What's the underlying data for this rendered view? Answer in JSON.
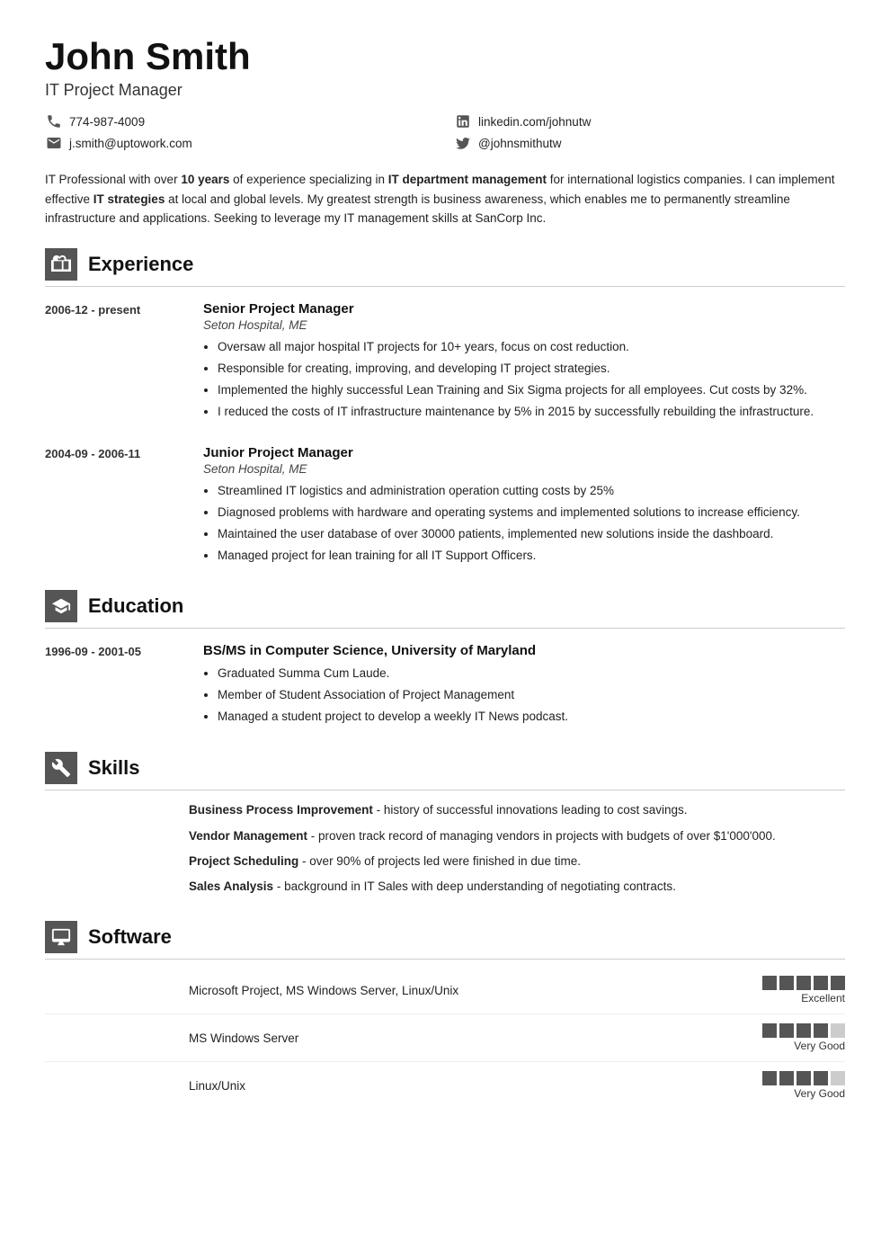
{
  "header": {
    "name": "John Smith",
    "title": "IT Project Manager"
  },
  "contact": [
    {
      "icon": "phone",
      "text": "774-987-4009"
    },
    {
      "icon": "linkedin",
      "text": "linkedin.com/johnutw"
    },
    {
      "icon": "email",
      "text": "j.smith@uptowork.com"
    },
    {
      "icon": "twitter",
      "text": "@johnsmithutw"
    }
  ],
  "summary": "IT Professional with over 10 years of experience specializing in IT department management for international logistics companies. I can implement effective IT strategies at local and global levels. My greatest strength is business awareness, which enables me to permanently streamline infrastructure and applications. Seeking to leverage my IT management skills at SanCorp Inc.",
  "summary_bold": [
    "10 years",
    "IT department management",
    "IT strategies"
  ],
  "sections": {
    "experience": {
      "title": "Experience",
      "entries": [
        {
          "date": "2006-12 - present",
          "job_title": "Senior Project Manager",
          "company": "Seton Hospital, ME",
          "bullets": [
            "Oversaw all major hospital IT projects for 10+ years, focus on cost reduction.",
            "Responsible for creating, improving, and developing IT project strategies.",
            "Implemented the highly successful Lean Training and Six Sigma projects for all employees. Cut costs by 32%.",
            "I reduced the costs of IT infrastructure maintenance by 5% in 2015 by successfully rebuilding the infrastructure."
          ]
        },
        {
          "date": "2004-09 - 2006-11",
          "job_title": "Junior Project Manager",
          "company": "Seton Hospital, ME",
          "bullets": [
            "Streamlined IT logistics and administration operation cutting costs by 25%",
            "Diagnosed problems with hardware and operating systems and implemented solutions to increase efficiency.",
            "Maintained the user database of over 30000 patients, implemented new solutions inside the dashboard.",
            "Managed project for lean training for all IT Support Officers."
          ]
        }
      ]
    },
    "education": {
      "title": "Education",
      "entries": [
        {
          "date": "1996-09 - 2001-05",
          "degree": "BS/MS in Computer Science, University of Maryland",
          "bullets": [
            "Graduated Summa Cum Laude.",
            "Member of Student Association of Project Management",
            "Managed a student project to develop a weekly IT News podcast."
          ]
        }
      ]
    },
    "skills": {
      "title": "Skills",
      "items": [
        {
          "name": "Business Process Improvement",
          "desc": "history of successful innovations leading to cost savings."
        },
        {
          "name": "Vendor Management",
          "desc": "proven track record of managing vendors in projects with budgets of over $1'000'000."
        },
        {
          "name": "Project Scheduling",
          "desc": "over 90% of projects led were finished in due time."
        },
        {
          "name": "Sales Analysis",
          "desc": "background in IT Sales with deep understanding of negotiating contracts."
        }
      ]
    },
    "software": {
      "title": "Software",
      "items": [
        {
          "name": "Microsoft Project, MS Windows Server, Linux/Unix",
          "rating": 5,
          "label": "Excellent"
        },
        {
          "name": "MS Windows Server",
          "rating": 4,
          "label": "Very Good"
        },
        {
          "name": "Linux/Unix",
          "rating": 4,
          "label": "Very Good"
        }
      ]
    }
  }
}
